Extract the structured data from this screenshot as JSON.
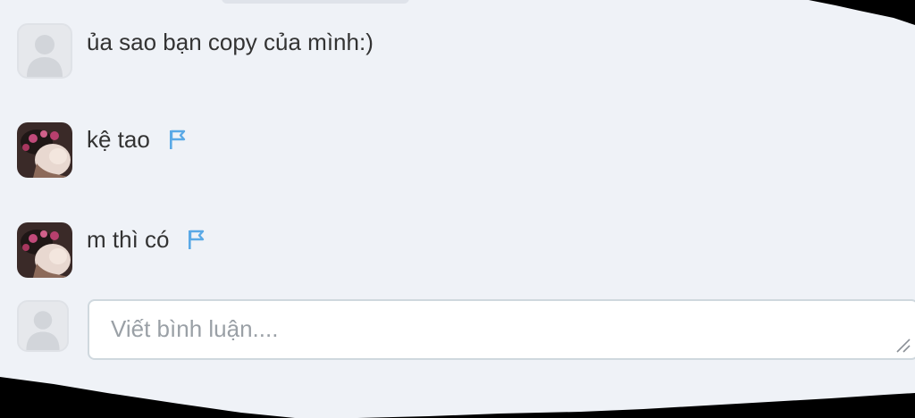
{
  "comments": [
    {
      "text": "ủa sao bạn copy của mình:)",
      "avatar": "default-user-icon",
      "has_flag": false
    },
    {
      "text": "kệ tao",
      "avatar": "user-photo",
      "has_flag": true
    },
    {
      "text": "m thì có",
      "avatar": "user-photo",
      "has_flag": true
    }
  ],
  "composer": {
    "placeholder": "Viết bình luận....",
    "value": ""
  },
  "colors": {
    "panel_bg": "#eff2f7",
    "flag": "#5aa9e6",
    "text": "#333333",
    "placeholder": "#9aa0a6"
  }
}
